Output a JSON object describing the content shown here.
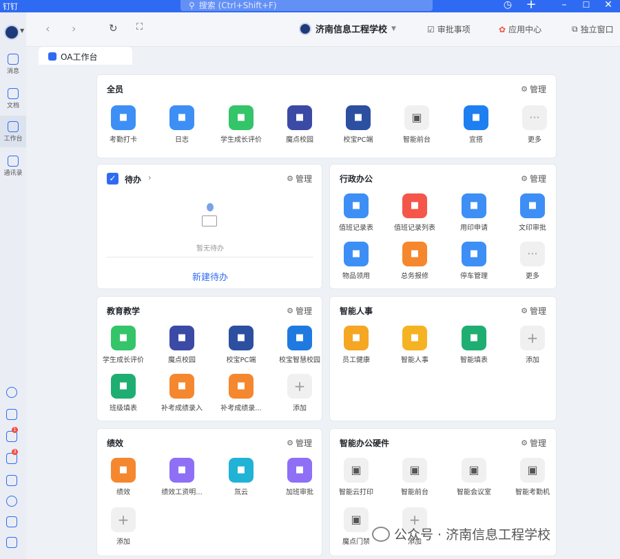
{
  "titlebar": {
    "app_name": "钉钉",
    "search_placeholder": "搜索 (Ctrl+Shift+F)"
  },
  "colors": {
    "accent": "#2f6bf2",
    "badge": "#f54a45"
  },
  "leftbar": {
    "items": [
      {
        "label": "消息",
        "icon": "message-icon"
      },
      {
        "label": "文档",
        "icon": "document-icon"
      },
      {
        "label": "工作台",
        "icon": "workbench-icon"
      },
      {
        "label": "通讯录",
        "icon": "contacts-icon"
      }
    ],
    "badges": [
      "1",
      "3"
    ]
  },
  "toolbar": {
    "org_name": "济南信息工程学校",
    "approval": "审批事项",
    "app_center": "应用中心",
    "standalone": "独立窗口"
  },
  "tab": {
    "label": "OA工作台"
  },
  "common": {
    "manage": "管理"
  },
  "sections": {
    "all": {
      "title": "全员",
      "apps": [
        {
          "label": "考勤打卡",
          "color": "#3d8ff5"
        },
        {
          "label": "日志",
          "color": "#3d8ff5"
        },
        {
          "label": "学生成长评价",
          "color": "#34c46a"
        },
        {
          "label": "魔点校园",
          "color": "#3b4aa5"
        },
        {
          "label": "校宝PC端",
          "color": "#2c4fa0"
        },
        {
          "label": "智能前台",
          "color": "#f0f0f0"
        },
        {
          "label": "宜搭",
          "color": "#1d7ff0"
        },
        {
          "label": "更多",
          "color": "#f0f0f0"
        }
      ]
    },
    "todo": {
      "title": "待办",
      "empty": "暂无待办",
      "new": "新建待办"
    },
    "admin": {
      "title": "行政办公",
      "apps": [
        {
          "label": "值班记录表",
          "color": "#3d8ff5"
        },
        {
          "label": "值班记录列表",
          "color": "#f5564a"
        },
        {
          "label": "用印申请",
          "color": "#3d8ff5"
        },
        {
          "label": "文印审批",
          "color": "#3d8ff5"
        },
        {
          "label": "物品领用",
          "color": "#3d8ff5"
        },
        {
          "label": "总务报修",
          "color": "#f5872f"
        },
        {
          "label": "停车管理",
          "color": "#3d8ff5"
        },
        {
          "label": "更多",
          "color": "#f0f0f0"
        }
      ]
    },
    "edu": {
      "title": "教育教学",
      "apps": [
        {
          "label": "学生成长评价",
          "color": "#34c46a"
        },
        {
          "label": "魔点校园",
          "color": "#3b4aa5"
        },
        {
          "label": "校宝PC端",
          "color": "#2c4fa0"
        },
        {
          "label": "校宝智慧校园",
          "color": "#1f7ae0"
        },
        {
          "label": "班级填表",
          "color": "#1fae72"
        },
        {
          "label": "补考成绩录入",
          "color": "#f5872f"
        },
        {
          "label": "补考成绩录...",
          "color": "#f5872f"
        },
        {
          "label": "添加",
          "color": "#f0f0f0"
        }
      ]
    },
    "hr": {
      "title": "智能人事",
      "apps": [
        {
          "label": "员工健康",
          "color": "#f5a623"
        },
        {
          "label": "智能人事",
          "color": "#f5b323"
        },
        {
          "label": "智能填表",
          "color": "#1fae72"
        },
        {
          "label": "添加",
          "color": "#f0f0f0"
        }
      ]
    },
    "perf": {
      "title": "绩效",
      "apps": [
        {
          "label": "绩效",
          "color": "#f5872f"
        },
        {
          "label": "绩效工资明...",
          "color": "#8e6ff5"
        },
        {
          "label": "氚云",
          "color": "#20b3d6"
        },
        {
          "label": "加班审批",
          "color": "#8e6ff5"
        },
        {
          "label": "添加",
          "color": "#f0f0f0"
        }
      ]
    },
    "hw": {
      "title": "智能办公硬件",
      "apps": [
        {
          "label": "智能云打印",
          "color": "#f0f0f0"
        },
        {
          "label": "智能前台",
          "color": "#f0f0f0"
        },
        {
          "label": "智能会议室",
          "color": "#f0f0f0"
        },
        {
          "label": "智能考勤机",
          "color": "#f0f0f0"
        },
        {
          "label": "魔点门禁",
          "color": "#f0f0f0"
        },
        {
          "label": "添加",
          "color": "#f0f0f0"
        }
      ]
    }
  },
  "watermark": "公众号 · 济南信息工程学校"
}
